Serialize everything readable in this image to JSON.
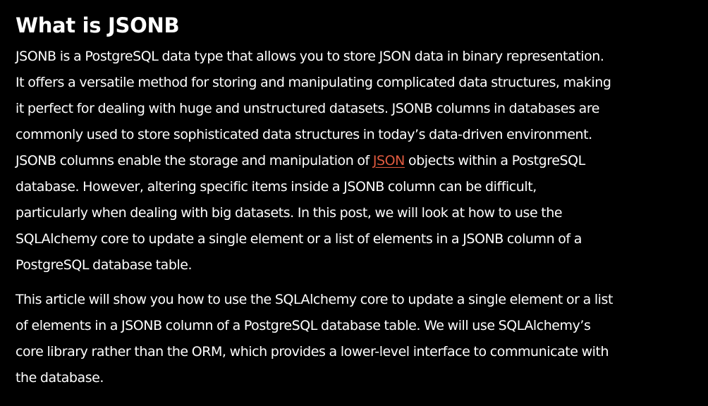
{
  "article": {
    "heading": "What is JSONB",
    "paragraph1": {
      "line1": "JSONB is a PostgreSQL data type that allows you to store JSON data in binary representation.",
      "line2": "It offers a versatile method for storing and manipulating complicated data structures, making",
      "line3": "it perfect for dealing with huge and unstructured datasets. JSONB columns in databases are",
      "line4": "commonly used to store sophisticated data structures in today’s data-driven environment.",
      "line5_before_link": "JSONB columns enable the storage and manipulation of ",
      "link_text": "JSON",
      "line5_after_link": " objects within a PostgreSQL",
      "line6": "database. However, altering specific items inside a JSONB column can be difficult,",
      "line7": "particularly when dealing with big datasets. In this post, we will look at how to use the",
      "line8": "SQLAlchemy core to update a single element or a list of elements in a JSONB column of a",
      "line9": "PostgreSQL database table."
    },
    "paragraph2": {
      "line1": "This article will show you how to use the SQLAlchemy core to update a single element or a list",
      "line2": "of elements in a JSONB column of a PostgreSQL database table. We will use SQLAlchemy’s",
      "line3": "core library rather than the ORM, which provides a lower-level interface to communicate with",
      "line4": "the database."
    }
  },
  "colors": {
    "background": "#000000",
    "text": "#ffffff",
    "link": "#e05a3f"
  }
}
